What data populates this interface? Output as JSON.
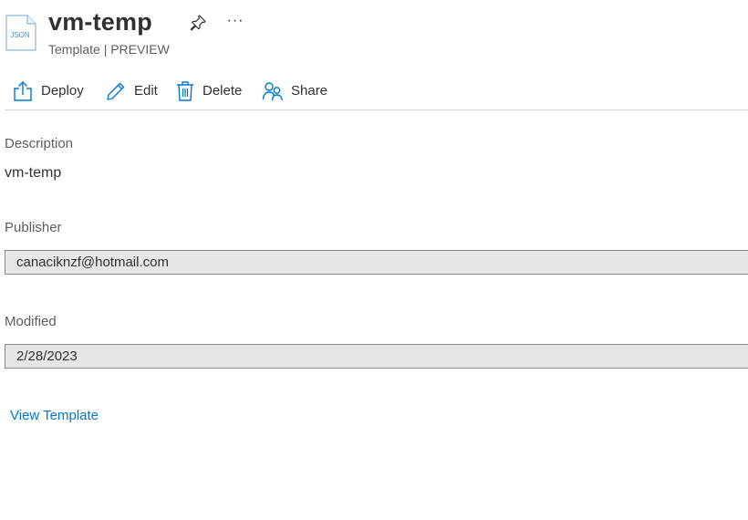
{
  "header": {
    "title": "vm-temp",
    "subtitle": "Template | PREVIEW",
    "file_icon": "json-file-icon",
    "file_icon_text": "JSON",
    "more_label": "···"
  },
  "toolbar": {
    "deploy_label": "Deploy",
    "edit_label": "Edit",
    "delete_label": "Delete",
    "share_label": "Share"
  },
  "fields": {
    "description_label": "Description",
    "description_value": "vm-temp",
    "publisher_label": "Publisher",
    "publisher_value": "canaciknzf@hotmail.com",
    "modified_label": "Modified",
    "modified_value": "2/28/2023"
  },
  "links": {
    "view_template": "View Template"
  },
  "colors": {
    "accent": "#0078d4",
    "text": "#323130",
    "secondary_text": "#605e5c",
    "readonly_bg": "#e6e6e6"
  }
}
